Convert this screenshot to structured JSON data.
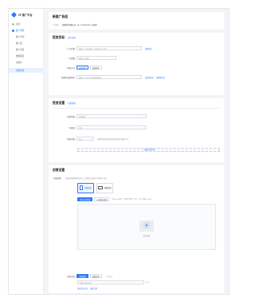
{
  "sidebar": {
    "logo_text": "ZF 推广平台",
    "items": [
      {
        "label": "总览",
        "type": "top"
      },
      {
        "label": "推广管理",
        "type": "group"
      },
      {
        "label": "推广计划",
        "type": "sub"
      },
      {
        "label": "推广组",
        "type": "sub"
      },
      {
        "label": "推广创意",
        "type": "sub"
      },
      {
        "label": "数据报表",
        "type": "sub"
      },
      {
        "label": "资源库",
        "type": "sub"
      },
      {
        "label": "新建创意",
        "type": "active"
      }
    ]
  },
  "header": {
    "title": "新建广告组",
    "account_label": "广告账户",
    "account_value": "某某科技有限公司（ID: 1234567890）· 投放中"
  },
  "target": {
    "title": "投放目标",
    "link": "填写说明",
    "fields": {
      "name_label": "广告名称",
      "name_placeholder": "请输入广告组名称，不超过50个字符",
      "name_link": "查看规范",
      "budget_label": "日预算",
      "budget_placeholder": "请输入日预算",
      "delivery_label": "投放方式",
      "delivery_options": [
        "均匀投放",
        "加速投放"
      ],
      "url_label": "落地页链接地址",
      "url_placeholder": "请输入以 http 开头的链接地址",
      "url_actions": [
        "选择落地页",
        "新建落地页"
      ]
    }
  },
  "audience": {
    "title": "投放设置",
    "link": "查看帮助",
    "fields": {
      "region_label": "投放地域",
      "region_placeholder": "不限地域",
      "age_label": "年龄段",
      "age_placeholder": "不限",
      "schedule_label": "投放时段",
      "schedule_value": "全天",
      "schedule_hint": "选择时段后系统将在指定时段内投放广告",
      "add_label": "+ 添加定向条件"
    }
  },
  "creative": {
    "title": "创意设置",
    "type_label": "创意类型",
    "type_hint": "请选择创意的展示样式，不同样式适用于不同的广告位",
    "types": [
      "竖版视频",
      "横版视频"
    ],
    "source_tabs": [
      "本地上传素材",
      "从素材库选择"
    ],
    "source_hint": "支持 mp4 格式，分辨率不低于 720P，大小不超过 500M",
    "empty_text": "暂无素材",
    "button_label": "按钮文案",
    "button_options": [
      "立即咨询",
      "免费试用",
      "了解详情"
    ],
    "button_placeholder": "请输入按钮文案",
    "button_count": "0/8",
    "footer_links": [
      "添加行动号召",
      "查看示例"
    ]
  }
}
